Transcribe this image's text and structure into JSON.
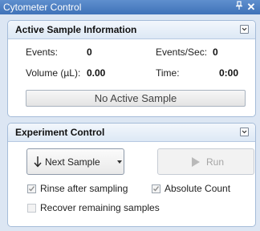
{
  "window": {
    "title": "Cytometer Control",
    "pin_glyph": "ᵖ",
    "close_glyph": "✕",
    "pin_icon": "pin-icon",
    "close_icon": "close-icon"
  },
  "active_sample": {
    "header": "Active Sample Information",
    "events_label": "Events:",
    "events_value": "0",
    "events_sec_label": "Events/Sec:",
    "events_sec_value": "0",
    "volume_label": "Volume (µL):",
    "volume_value": "0.00",
    "time_label": "Time:",
    "time_value": "0:00",
    "status_button": "No Active Sample"
  },
  "experiment": {
    "header": "Experiment Control",
    "next_button": "Next Sample",
    "run_button": "Run",
    "rinse_label": "Rinse after sampling",
    "rinse_checked": true,
    "absolute_label": "Absolute Count",
    "absolute_checked": true,
    "recover_label": "Recover remaining samples",
    "recover_checked": false
  },
  "colors": {
    "titlebar": "#4a7cc0",
    "panel_border": "#a5bcd9",
    "disabled_text": "#a5a5a5"
  }
}
